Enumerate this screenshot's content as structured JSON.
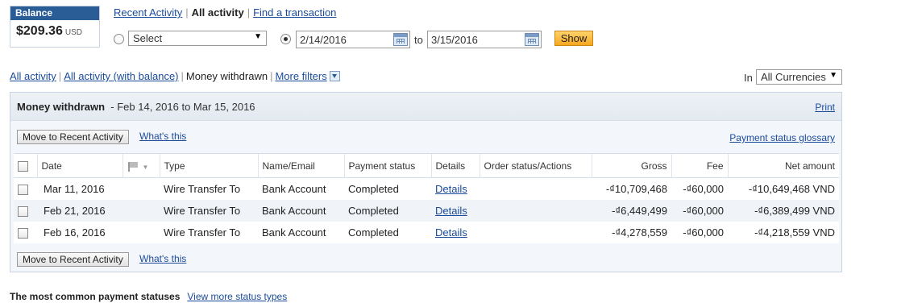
{
  "balance": {
    "label": "Balance",
    "amount": "$209.36",
    "currency": "USD"
  },
  "top_nav": {
    "recent_activity": "Recent Activity",
    "all_activity": "All activity",
    "find_transaction": "Find a transaction"
  },
  "date_filter": {
    "select_label": "Select",
    "from_date": "2/14/2016",
    "to_label": "to",
    "to_date": "3/15/2016",
    "show_button": "Show"
  },
  "filter_tabs": {
    "all_activity": "All activity",
    "all_with_balance": "All activity (with balance)",
    "money_withdrawn": "Money withdrawn",
    "more_filters": "More filters"
  },
  "currency_filter": {
    "in_label": "In",
    "selected": "All Currencies"
  },
  "panel": {
    "title": "Money withdrawn",
    "range": "- Feb 14, 2016 to Mar 15, 2016",
    "print": "Print",
    "move_button": "Move to Recent Activity",
    "whats_this": "What's this",
    "glossary": "Payment status glossary"
  },
  "table": {
    "headers": {
      "date": "Date",
      "type": "Type",
      "name": "Name/Email",
      "status": "Payment status",
      "details": "Details",
      "order": "Order status/Actions",
      "gross": "Gross",
      "fee": "Fee",
      "net": "Net amount"
    },
    "rows": [
      {
        "date": "Mar 11, 2016",
        "type": "Wire Transfer To",
        "name": "Bank Account",
        "status": "Completed",
        "details": "Details",
        "order": "",
        "gross": "-₫10,709,468",
        "fee": "-₫60,000",
        "net": "-₫10,649,468 VND"
      },
      {
        "date": "Feb 21, 2016",
        "type": "Wire Transfer To",
        "name": "Bank Account",
        "status": "Completed",
        "details": "Details",
        "order": "",
        "gross": "-₫6,449,499",
        "fee": "-₫60,000",
        "net": "-₫6,389,499 VND"
      },
      {
        "date": "Feb 16, 2016",
        "type": "Wire Transfer To",
        "name": "Bank Account",
        "status": "Completed",
        "details": "Details",
        "order": "",
        "gross": "-₫4,278,559",
        "fee": "-₫60,000",
        "net": "-₫4,218,559 VND"
      }
    ]
  },
  "common_statuses": {
    "label": "The most common payment statuses",
    "link": "View more status types"
  },
  "colors": {
    "brand_blue": "#2a5d96",
    "link": "#1a4b9b",
    "show_button": "#f6a71e"
  }
}
